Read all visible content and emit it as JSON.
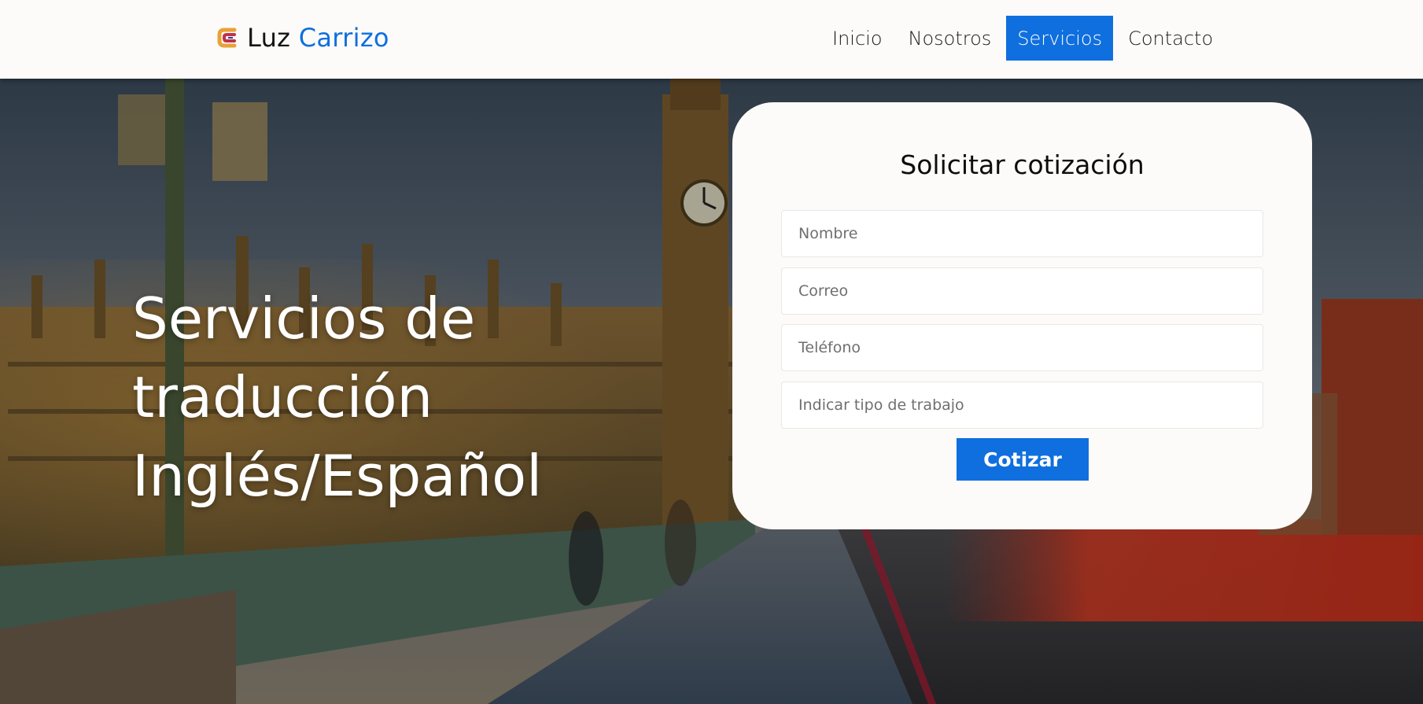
{
  "brand": {
    "first": "Luz",
    "last": "Carrizo",
    "icon": "luz-carrizo-logo-icon"
  },
  "nav": {
    "items": [
      {
        "label": "Inicio",
        "active": false
      },
      {
        "label": "Nosotros",
        "active": false
      },
      {
        "label": "Servicios",
        "active": true
      },
      {
        "label": "Contacto",
        "active": false
      }
    ]
  },
  "hero": {
    "title_lines": [
      "Servicios de",
      "traducción",
      "Inglés/Español"
    ],
    "background": "london-westminster-bridge-photo"
  },
  "form": {
    "title": "Solicitar cotización",
    "fields": [
      {
        "placeholder": "Nombre",
        "value": ""
      },
      {
        "placeholder": "Correo",
        "value": ""
      },
      {
        "placeholder": "Teléfono",
        "value": ""
      },
      {
        "placeholder": "Indicar tipo de trabajo",
        "value": ""
      }
    ],
    "submit_label": "Cotizar"
  },
  "colors": {
    "accent": "#0f6fde",
    "header_bg": "#fcfbfa",
    "card_bg": "#fcfbfa"
  }
}
